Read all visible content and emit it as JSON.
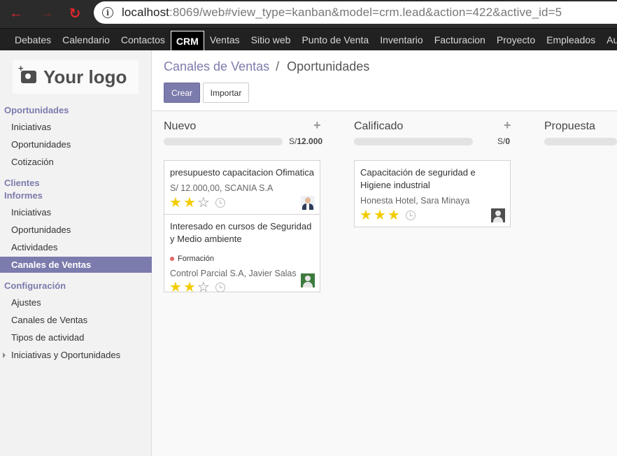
{
  "browser": {
    "url_host": "localhost",
    "url_rest": ":8069/web#view_type=kanban&model=crm.lead&action=422&active_id=5",
    "info_glyph": "i"
  },
  "menu": {
    "items": [
      "Debates",
      "Calendario",
      "Contactos",
      "CRM",
      "Ventas",
      "Sitio web",
      "Punto de Venta",
      "Inventario",
      "Facturacion",
      "Proyecto",
      "Empleados",
      "Ausencias"
    ],
    "active": "CRM"
  },
  "sidebar": {
    "logo_text": "Your logo",
    "sections": {
      "oportunidades": "Oportunidades",
      "clientes": "Clientes",
      "informes": "Informes",
      "configuracion": "Configuración"
    },
    "oportunidades_items": [
      "Iniciativas",
      "Oportunidades",
      "Cotización"
    ],
    "informes_items": [
      "Iniciativas",
      "Oportunidades",
      "Actividades",
      "Canales de Ventas"
    ],
    "configuracion_items": [
      "Ajustes",
      "Canales de Ventas",
      "Tipos de actividad",
      "Iniciativas y Oportunidades"
    ]
  },
  "main": {
    "breadcrumb": {
      "parent": "Canales de Ventas",
      "separator": "/",
      "current": "Oportunidades"
    },
    "buttons": {
      "create": "Crear",
      "import": "Importar"
    },
    "columns": [
      {
        "title": "Nuevo",
        "plus": "+",
        "total_prefix": "S/",
        "total_value": "12.000",
        "cards": [
          {
            "title": "presupuesto capacitacion Ofimatica",
            "subtitle": "S/ 12.000,00, SCANIA S.A",
            "stars": 2,
            "avatar": "suit"
          },
          {
            "title_line1": "Interesado en cursos de Seguridad",
            "title_line2": "y Medio ambiente",
            "tag": "Formación",
            "subtitle": "Control Parcial S.A, Javier Salas",
            "stars": 2,
            "avatar": "green"
          }
        ]
      },
      {
        "title": "Calificado",
        "plus": "+",
        "total_prefix": "S/",
        "total_value": "0",
        "cards": [
          {
            "title_line1": "Capacitación de seguridad e",
            "title_line2": "Higiene industrial",
            "subtitle": "Honesta Hotel, Sara Minaya",
            "stars": 3,
            "avatar": "gray"
          }
        ]
      },
      {
        "title": "Propuesta"
      }
    ]
  },
  "colors": {
    "accent": "#7c7bad",
    "menubar": "#212121",
    "star_on": "#f3cc00",
    "tag_dot": "#e06666"
  }
}
